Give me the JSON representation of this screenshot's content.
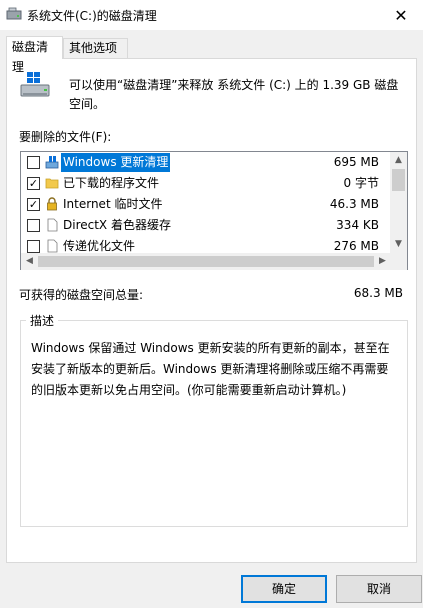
{
  "window": {
    "title": "系统文件(C:)的磁盘清理",
    "close_glyph": "✕"
  },
  "tabs": [
    {
      "label": "磁盘清理",
      "active": true
    },
    {
      "label": "其他选项",
      "active": false
    }
  ],
  "summary_text": "可以使用“磁盘清理”来释放 系统文件 (C:) 上的 1.39 GB 磁盘空间。",
  "files_label": "要删除的文件(F):",
  "files": [
    {
      "name": "Windows 更新清理",
      "size": "695 MB",
      "checked": false,
      "selected": true,
      "icon": "windows-update-icon"
    },
    {
      "name": "已下载的程序文件",
      "size": "0 字节",
      "checked": true,
      "selected": false,
      "icon": "folder-icon"
    },
    {
      "name": "Internet 临时文件",
      "size": "46.3 MB",
      "checked": true,
      "selected": false,
      "icon": "lock-icon"
    },
    {
      "name": "DirectX 着色器缓存",
      "size": "334 KB",
      "checked": false,
      "selected": false,
      "icon": "file-icon"
    },
    {
      "name": "传递优化文件",
      "size": "276 MB",
      "checked": false,
      "selected": false,
      "icon": "file-icon"
    }
  ],
  "total": {
    "label": "可获得的磁盘空间总量:",
    "value": "68.3 MB"
  },
  "description": {
    "title": "描述",
    "text": "Windows 保留通过 Windows 更新安装的所有更新的副本，甚至在安装了新版本的更新后。Windows 更新清理将删除或压缩不再需要的旧版本更新以免占用空间。(你可能需要重新启动计算机。)"
  },
  "buttons": {
    "ok": "确定",
    "cancel": "取消"
  },
  "colors": {
    "selection": "#0078d7",
    "accent": "#0078d7"
  }
}
